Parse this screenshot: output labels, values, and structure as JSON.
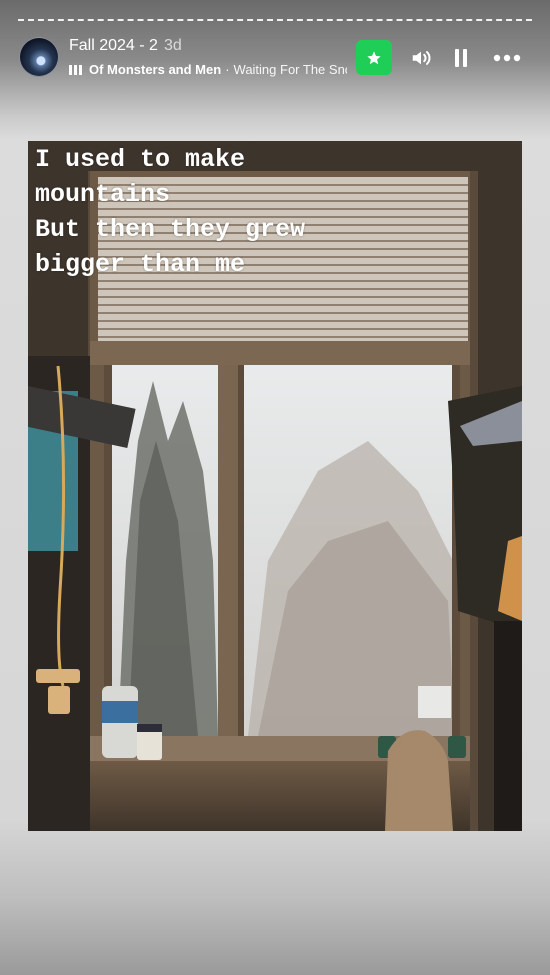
{
  "header": {
    "title": "Fall 2024 - 2",
    "age": "3d",
    "music": {
      "artist": "Of Monsters and Men",
      "separator": "·",
      "track": "Waiting For The Snow"
    }
  },
  "icons": {
    "star": "star-icon",
    "volume": "volume-icon",
    "pause": "pause-icon",
    "more": "more-icon",
    "equalizer": "equalizer-icon"
  },
  "story": {
    "caption": "I used to make\nmountains\nBut then they grew\nbigger than me"
  },
  "colors": {
    "accent": "#1fce57"
  }
}
